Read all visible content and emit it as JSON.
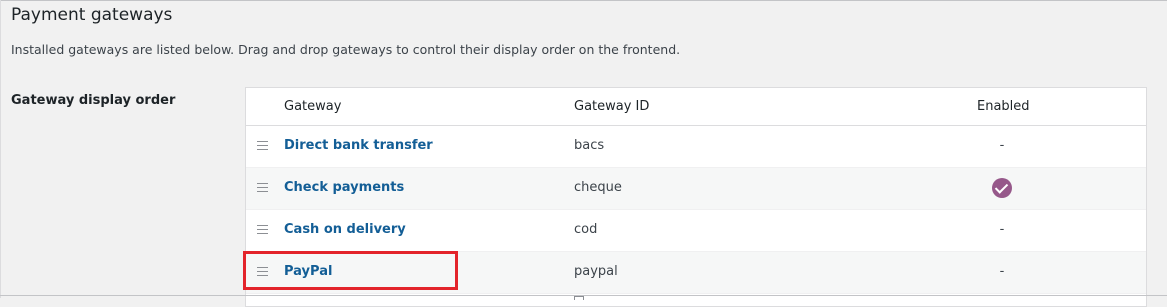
{
  "section": {
    "title": "Payment gateways",
    "description": "Installed gateways are listed below. Drag and drop gateways to control their display order on the frontend.",
    "field_label": "Gateway display order"
  },
  "table": {
    "headers": {
      "gateway": "Gateway",
      "gateway_id": "Gateway ID",
      "enabled": "Enabled"
    },
    "rows": [
      {
        "name": "Direct bank transfer",
        "id": "bacs",
        "enabled": "-",
        "enabled_state": false
      },
      {
        "name": "Check payments",
        "id": "cheque",
        "enabled": "",
        "enabled_state": true
      },
      {
        "name": "Cash on delivery",
        "id": "cod",
        "enabled": "-",
        "enabled_state": false
      },
      {
        "name": "PayPal",
        "id": "paypal",
        "enabled": "-",
        "enabled_state": false
      }
    ]
  },
  "colors": {
    "link": "#135e96",
    "enabled_check": "#96588a",
    "highlight": "#e3242b"
  },
  "icons": {
    "drag_handle": "drag-handle-icon",
    "enabled": "checkmark-circle-icon"
  }
}
